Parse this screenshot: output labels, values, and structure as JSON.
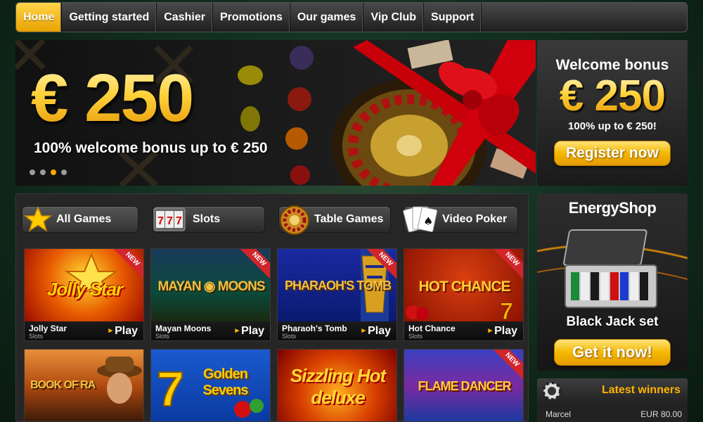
{
  "nav": {
    "items": [
      {
        "label": "Home",
        "active": true
      },
      {
        "label": "Getting started"
      },
      {
        "label": "Cashier"
      },
      {
        "label": "Promotions"
      },
      {
        "label": "Our games"
      },
      {
        "label": "Vip Club"
      },
      {
        "label": "Support"
      }
    ]
  },
  "hero": {
    "amount": "€ 250",
    "subtitle": "100% welcome bonus up to € 250",
    "slides": 4,
    "active_slide": 3
  },
  "welcome": {
    "title": "Welcome bonus",
    "amount": "€ 250",
    "subtitle": "100% up to € 250!",
    "button": "Register now"
  },
  "tabs": [
    {
      "label": "All Games",
      "icon": "star-icon"
    },
    {
      "label": "Slots",
      "icon": "slot-777-icon"
    },
    {
      "label": "Table Games",
      "icon": "roulette-icon"
    },
    {
      "label": "Video Poker",
      "icon": "cards-icon"
    }
  ],
  "games": [
    {
      "name": "Jolly Star",
      "category": "Slots",
      "play": "Play",
      "badge": "NEW",
      "logo": "Jolly Star"
    },
    {
      "name": "Mayan Moons",
      "category": "Slots",
      "play": "Play",
      "badge": "NEW",
      "logo": "MAYAN ◉ MOONS"
    },
    {
      "name": "Pharaoh's Tomb",
      "category": "Slots",
      "play": "Play",
      "badge": "NEW",
      "logo": "PHARAOH'S TOMB"
    },
    {
      "name": "Hot Chance",
      "category": "Slots",
      "play": "Play",
      "badge": "NEW",
      "logo": "HOT CHANCE"
    },
    {
      "name": "",
      "category": "",
      "play": "",
      "badge": "",
      "logo": "BOOK OF RA"
    },
    {
      "name": "",
      "category": "",
      "play": "",
      "badge": "",
      "logo": "Golden Sevens"
    },
    {
      "name": "",
      "category": "",
      "play": "",
      "badge": "",
      "logo": "Sizzling Hot deluxe"
    },
    {
      "name": "",
      "category": "",
      "play": "",
      "badge": "NEW",
      "logo": "FLAME DANCER"
    }
  ],
  "shop": {
    "title": "EnergyShop",
    "item": "Black Jack set",
    "button": "Get it now!"
  },
  "winners": {
    "title": "Latest winners",
    "rows": [
      {
        "name": "Marcel",
        "amount": "EUR 80.00"
      }
    ]
  },
  "colors": {
    "accent": "#ffb400",
    "ribbon": "#d2252b"
  }
}
